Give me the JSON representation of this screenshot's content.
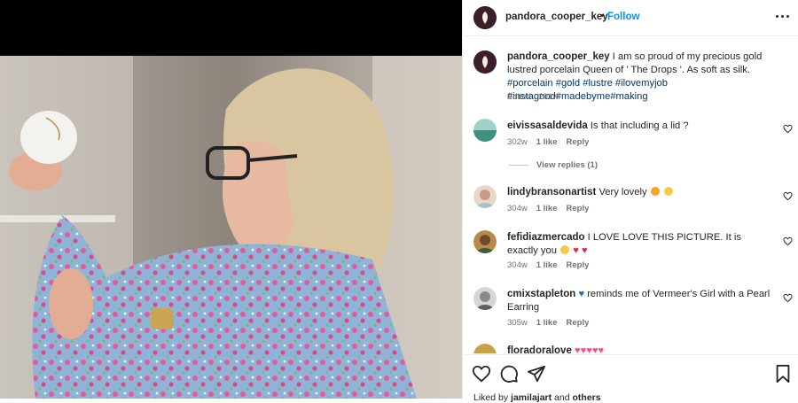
{
  "post": {
    "username": "pandora_cooper_key",
    "dot": "•",
    "follow_label": "Follow",
    "caption_pre": " I am so proud of my precious gold lustred porcelain Queen of ' The Drops '. As soft as silk. ",
    "hashtags": [
      "#porcelain",
      "#gold",
      "#lustre",
      "#ilovemyjob",
      "#instagood",
      "#madebyme",
      "#making"
    ],
    "caption_meta": "Edited · 291w"
  },
  "comments": [
    {
      "username": "eivissasaldevida",
      "text": "Is that including a lid ?",
      "age": "302w",
      "likes": "1 like",
      "reply": "Reply"
    },
    {
      "username": "lindybransonartist",
      "text": "Very lovely",
      "age": "304w",
      "likes": "1 like",
      "reply": "Reply"
    },
    {
      "username": "fefidiazmercado",
      "text": "I LOVE LOVE THIS PICTURE. It is exactly you",
      "age": "304w",
      "likes": "1 like",
      "reply": "Reply"
    },
    {
      "username": "cmixstapleton",
      "text": "reminds me of Vermeer's Girl with a Pearl Earring",
      "age": "305w",
      "likes": "1 like",
      "reply": "Reply"
    },
    {
      "username": "floradoralove",
      "text": ""
    }
  ],
  "view_replies": "View replies (1)",
  "liked_by": {
    "prefix": "Liked by ",
    "user": "jamilajart",
    "and": " and ",
    "others": "others"
  },
  "colors": {
    "accent": "#0095f6",
    "hashtag": "#00376b",
    "muted": "#737373"
  },
  "icons": [
    "more-options-icon",
    "heart-icon",
    "comment-icon",
    "share-icon",
    "save-icon"
  ]
}
